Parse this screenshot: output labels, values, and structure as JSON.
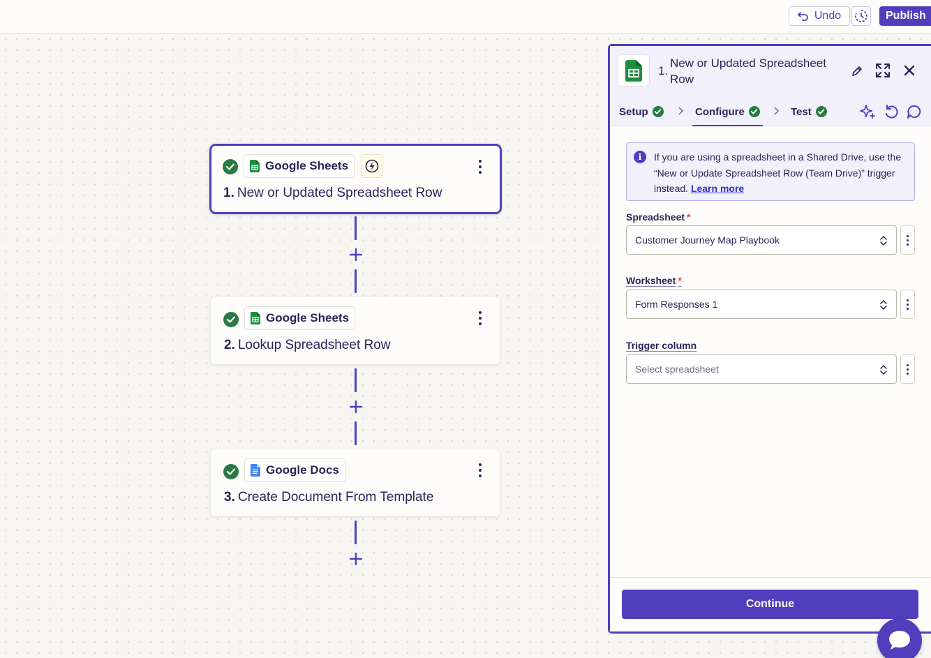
{
  "toolbar": {
    "undo_label": "Undo",
    "publish_label": "Publish"
  },
  "steps": [
    {
      "app": "Google Sheets",
      "number": "1.",
      "title": "New or Updated Spreadsheet Row",
      "app_icon": "google-sheets-icon",
      "trigger": true
    },
    {
      "app": "Google Sheets",
      "number": "2.",
      "title": "Lookup Spreadsheet Row",
      "app_icon": "google-sheets-icon"
    },
    {
      "app": "Google Docs",
      "number": "3.",
      "title": "Create Document From Template",
      "app_icon": "google-docs-icon"
    }
  ],
  "panel": {
    "step_number": "1.",
    "title": "New or Updated Spreadsheet Row",
    "tabs": [
      {
        "label": "Setup",
        "complete": true
      },
      {
        "label": "Configure",
        "complete": true,
        "active": true
      },
      {
        "label": "Test",
        "complete": true
      }
    ],
    "info": {
      "text": "If you are using a spreadsheet in a Shared Drive, use the “New or Update Spreadsheet Row (Team Drive)” trigger instead.",
      "link": "Learn more"
    },
    "fields": {
      "spreadsheet": {
        "label": "Spreadsheet",
        "required_mark": "*",
        "value": "Customer Journey Map Playbook"
      },
      "worksheet": {
        "label": "Worksheet",
        "required_mark": "*",
        "value": "Form Responses 1"
      },
      "trigger_column": {
        "label": "Trigger column",
        "placeholder": "Select spreadsheet"
      }
    },
    "continue_label": "Continue"
  },
  "colors": {
    "accent": "#503ebd",
    "success": "#2a7a43",
    "sheets_green": "#1e8e3e",
    "docs_blue": "#4285f4"
  }
}
